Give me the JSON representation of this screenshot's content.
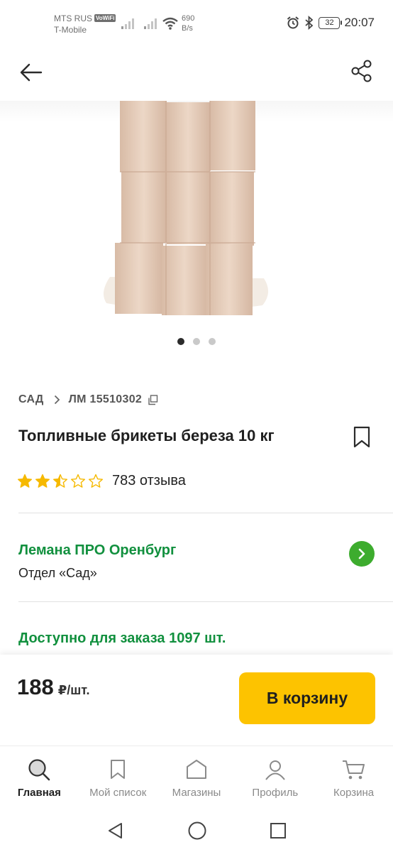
{
  "status_bar": {
    "carrier_primary": "MTS RUS",
    "vowifi_badge": "VoWiFi",
    "carrier_secondary": "T-Mobile",
    "speed_value": "690",
    "speed_unit": "B/s",
    "battery": "32",
    "time": "20:07"
  },
  "product": {
    "breadcrumb_category": "САД",
    "article": "ЛМ 15510302",
    "title": "Топливные брикеты береза 10 кг",
    "rating": 2.5,
    "rating_max": 5,
    "reviews": "783 отзыва",
    "gallery_count": 3,
    "gallery_active_index": 0
  },
  "store": {
    "name": "Лемана ПРО Оренбург",
    "department": "Отдел «Сад»"
  },
  "availability": "Доступно для заказа 1097 шт.",
  "price": {
    "value": "188",
    "unit": "₽/шт."
  },
  "cart_button": "В корзину",
  "bottom_nav": [
    {
      "label": "Главная",
      "icon": "search-icon",
      "active": true
    },
    {
      "label": "Мой список",
      "icon": "bookmark-icon",
      "active": false
    },
    {
      "label": "Магазины",
      "icon": "store-icon",
      "active": false
    },
    {
      "label": "Профиль",
      "icon": "profile-icon",
      "active": false
    },
    {
      "label": "Корзина",
      "icon": "cart-icon",
      "active": false
    }
  ],
  "colors": {
    "brand_green": "#11903e",
    "arrow_green": "#3dac2e",
    "cart_yellow": "#fdc300",
    "star_yellow": "#f6b900"
  }
}
